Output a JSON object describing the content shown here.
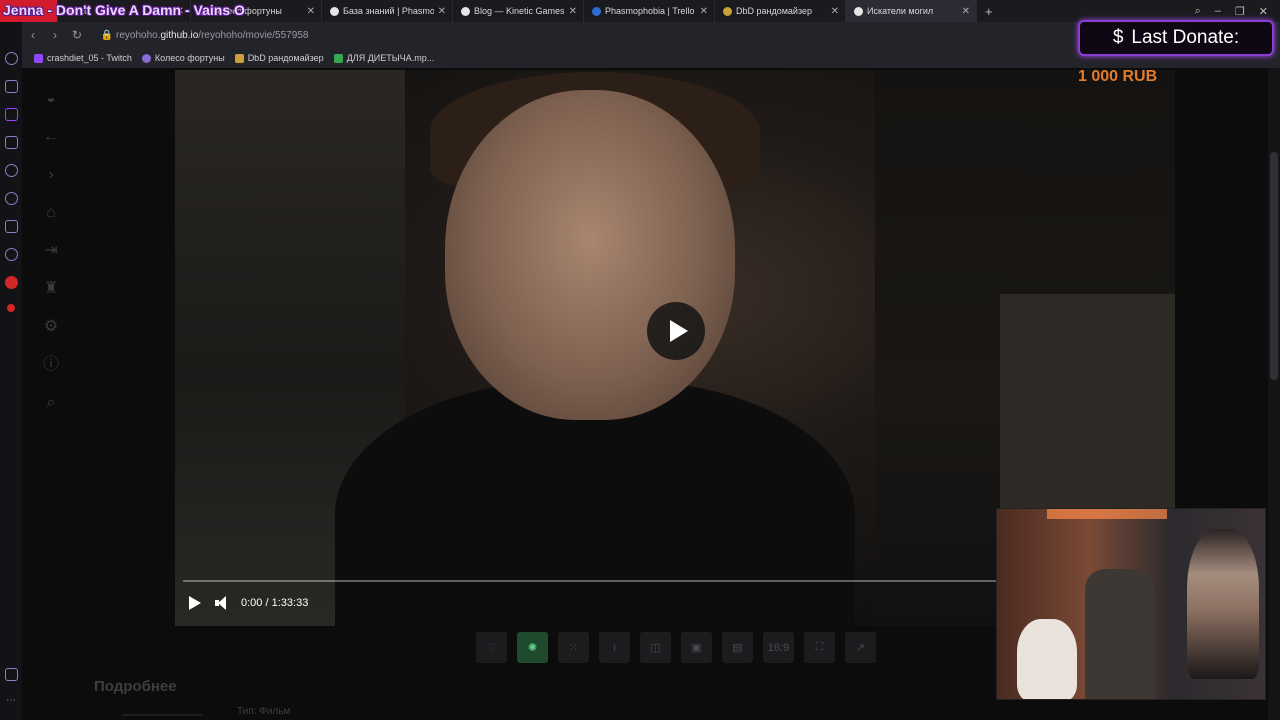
{
  "overlay": {
    "song_title": "Jenna - Don't Give A Damn - Vains O",
    "donate_label": "Last Donate:",
    "donate_currency_icon": "dollar-icon",
    "donate_symbol": "$",
    "donate_amount": "1 000 RUB"
  },
  "tabs": [
    {
      "label": "Колесо фортуны",
      "color": "#8a6bd6"
    },
    {
      "label": "База знаний | Phasmophobia",
      "color": "#e5e5e5"
    },
    {
      "label": "Blog — Kinetic Games",
      "color": "#e5e5e5"
    },
    {
      "label": "Phasmophobia | Trello",
      "color": "#2c6cd1"
    },
    {
      "label": "DbD рандомайзер",
      "color": "#c9a03a"
    },
    {
      "label": "Искатели могил",
      "color": "#e5e5e5",
      "active": true
    }
  ],
  "tab_close": "✕",
  "new_tab": "+",
  "address": {
    "url_prefix": "reyohoho.",
    "url_domain": "github.io",
    "url_path": "/reyohoho/movie/557958"
  },
  "bookmarks": [
    {
      "label": "crashdiet_05 - Twitch",
      "color": "#9147ff"
    },
    {
      "label": "Колесо фортуны",
      "color": "#8a6bd6"
    },
    {
      "label": "DbD рандомайзер",
      "color": "#c9a03a"
    },
    {
      "label": "ДЛЯ ДИЕТЫЧА.mp...",
      "color": "#34a853"
    }
  ],
  "player": {
    "current_time": "0:00",
    "separator": "/",
    "duration": "1:33:33",
    "progress": 0.0,
    "tool_badge": "16:9"
  },
  "page": {
    "more_title": "Подробнее",
    "type_label": "Тип: Фильм"
  },
  "colors": {
    "accent_purple": "#8b3fd1",
    "donate_orange": "#e27b2a",
    "opera_red": "#d21b2d",
    "tool_green": "#1f4a2c"
  }
}
